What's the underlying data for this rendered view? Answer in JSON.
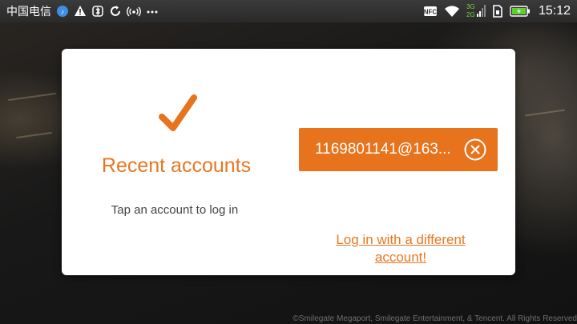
{
  "status_bar": {
    "carrier": "中国电信",
    "network_badge_3g": "3G",
    "network_badge_2g": "2G",
    "nfc_label": "NFC",
    "time": "15:12",
    "icons": [
      "notification-icon",
      "warning-icon",
      "bluetooth-icon",
      "sync-icon",
      "wifi-hotspot-icon",
      "more-icon",
      "nfc-icon",
      "wifi-icon",
      "signal-icon",
      "sim-icon",
      "battery-icon"
    ]
  },
  "dialog": {
    "title": "Recent accounts",
    "hint": "Tap an account to log in",
    "account": {
      "label": "1169801141@163..."
    },
    "alt_link": "Log in with a different account!"
  },
  "footer": {
    "copyright": "©Smilegate Megaport, Smilegate Entertainment, & Tencent. All Rights Reserved"
  },
  "colors": {
    "accent": "#e8731d",
    "title": "#e87622",
    "dialog_bg": "#ffffff"
  }
}
